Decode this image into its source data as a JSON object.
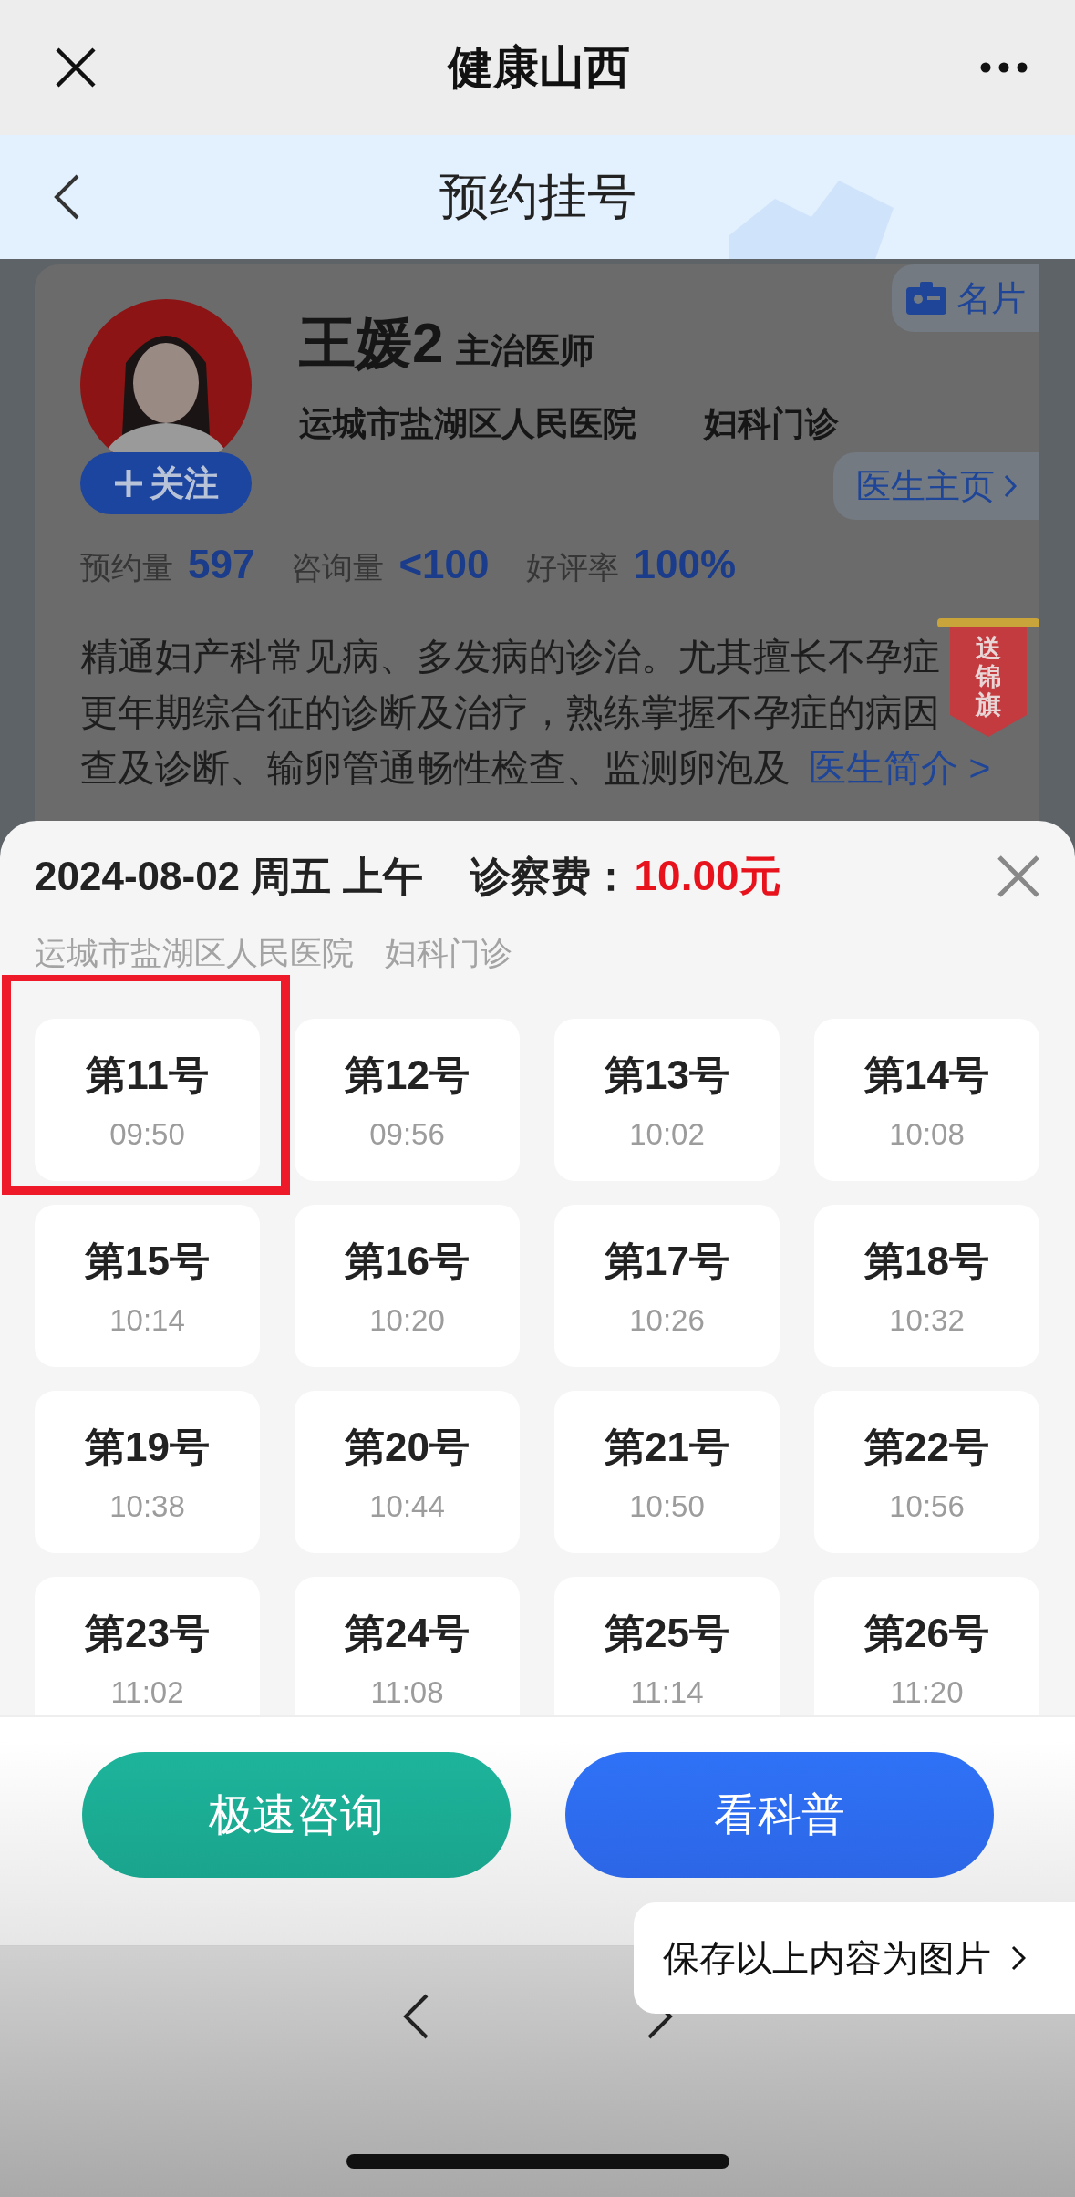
{
  "top_bar": {
    "title": "健康山西"
  },
  "nav_bar": {
    "title": "预约挂号"
  },
  "doctor": {
    "name": "王媛2",
    "rank": "主治医师",
    "hospital": "运城市盐湖区人民医院",
    "department": "妇科门诊",
    "follow_button": "关注",
    "card_tab": "名片",
    "homepage_link": "医生主页",
    "stats": [
      {
        "label": "预约量",
        "value": "597"
      },
      {
        "label": "咨询量",
        "value": "<100"
      },
      {
        "label": "好评率",
        "value": "100%"
      }
    ],
    "description_lines": [
      "精通妇产科常见病、多发病的诊治。尤其擅长不孕症",
      "更年期综合征的诊断及治疗，熟练掌握不孕症的病因",
      "查及诊断、输卵管通畅性检查、监测卵泡及"
    ],
    "intro_link": "医生简介 >",
    "banner_badge": "送锦旗"
  },
  "schedule": {
    "date": "2024-08-02 周五 上午",
    "fee_label": "诊察费：",
    "fee": "10.00元",
    "hospital": "运城市盐湖区人民医院",
    "department": "妇科门诊",
    "slots": [
      {
        "number": "第11号",
        "time": "09:50",
        "selected": true
      },
      {
        "number": "第12号",
        "time": "09:56",
        "selected": false
      },
      {
        "number": "第13号",
        "time": "10:02",
        "selected": false
      },
      {
        "number": "第14号",
        "time": "10:08",
        "selected": false
      },
      {
        "number": "第15号",
        "time": "10:14",
        "selected": false
      },
      {
        "number": "第16号",
        "time": "10:20",
        "selected": false
      },
      {
        "number": "第17号",
        "time": "10:26",
        "selected": false
      },
      {
        "number": "第18号",
        "time": "10:32",
        "selected": false
      },
      {
        "number": "第19号",
        "time": "10:38",
        "selected": false
      },
      {
        "number": "第20号",
        "time": "10:44",
        "selected": false
      },
      {
        "number": "第21号",
        "time": "10:50",
        "selected": false
      },
      {
        "number": "第22号",
        "time": "10:56",
        "selected": false
      },
      {
        "number": "第23号",
        "time": "11:02",
        "selected": false
      },
      {
        "number": "第24号",
        "time": "11:08",
        "selected": false
      },
      {
        "number": "第25号",
        "time": "11:14",
        "selected": false
      },
      {
        "number": "第26号",
        "time": "11:20",
        "selected": false
      }
    ]
  },
  "actions": [
    {
      "label": "极速咨询",
      "kind": "consult"
    },
    {
      "label": "看科普",
      "kind": "science"
    }
  ],
  "save_popup": {
    "label": "保存以上内容为图片"
  }
}
